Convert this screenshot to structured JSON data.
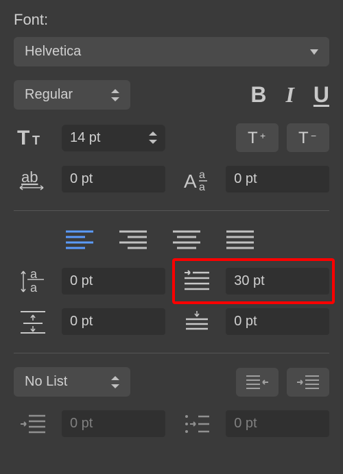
{
  "font": {
    "label": "Font:",
    "family": "Helvetica",
    "weight": "Regular",
    "size": "14 pt",
    "tracking": "0 pt",
    "baseline": "0 pt"
  },
  "paragraph": {
    "line_spacing": "0 pt",
    "first_line_indent": "30 pt",
    "space_before": "0 pt",
    "space_after": "0 pt"
  },
  "list": {
    "style": "No List",
    "text_indent": "0 pt",
    "number_indent": "0 pt"
  }
}
